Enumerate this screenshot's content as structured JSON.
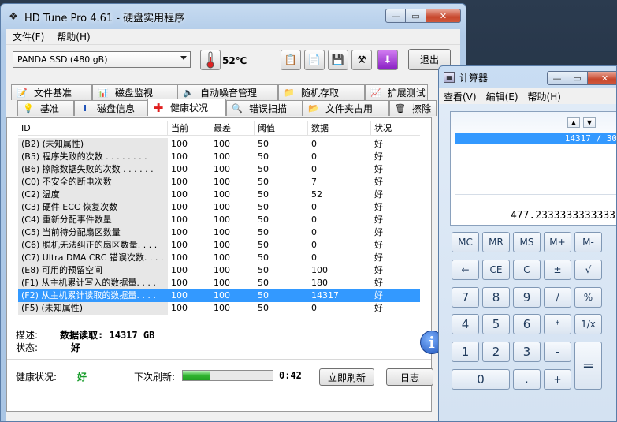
{
  "hdtune": {
    "title": "HD Tune Pro 4.61 - 硬盘实用程序",
    "menu": [
      "文件(F)",
      "帮助(H)"
    ],
    "drive": "PANDA SSD (480 gB)",
    "temperature": "52℃",
    "exit_label": "退出",
    "tabs_back": [
      {
        "label": "文件基准",
        "icon": "file-bench-icon"
      },
      {
        "label": "磁盘监视",
        "icon": "disk-monitor-icon"
      },
      {
        "label": "自动噪音管理",
        "icon": "speaker-icon"
      },
      {
        "label": "随机存取",
        "icon": "random-access-icon"
      },
      {
        "label": "扩展测试",
        "icon": "extra-tests-icon"
      }
    ],
    "tabs_front": [
      {
        "label": "基准",
        "icon": "bulb-icon"
      },
      {
        "label": "磁盘信息",
        "icon": "info-icon"
      },
      {
        "label": "健康状况",
        "icon": "health-cross-icon"
      },
      {
        "label": "错误扫描",
        "icon": "magnifier-icon"
      },
      {
        "label": "文件夹占用",
        "icon": "folder-icon"
      },
      {
        "label": "擦除",
        "icon": "trash-icon"
      }
    ],
    "columns": [
      "ID",
      "当前",
      "最差",
      "阈值",
      "数据",
      "状况"
    ],
    "rows": [
      [
        "(B2) (未知属性)",
        "100",
        "100",
        "50",
        "0",
        "好"
      ],
      [
        "(B5) 程序失败的次数 . . . . . . . .",
        "100",
        "100",
        "50",
        "0",
        "好"
      ],
      [
        "(B6) 擦除数据失败的次数 . . . . . .",
        "100",
        "100",
        "50",
        "0",
        "好"
      ],
      [
        "(C0) 不安全的断电次数",
        "100",
        "100",
        "50",
        "7",
        "好"
      ],
      [
        "(C2) 温度",
        "100",
        "100",
        "50",
        "52",
        "好"
      ],
      [
        "(C3) 硬件 ECC 恢复次数",
        "100",
        "100",
        "50",
        "0",
        "好"
      ],
      [
        "(C4) 重新分配事件数量",
        "100",
        "100",
        "50",
        "0",
        "好"
      ],
      [
        "(C5) 当前待分配扇区数量",
        "100",
        "100",
        "50",
        "0",
        "好"
      ],
      [
        "(C6) 脱机无法纠正的扇区数量. . . .",
        "100",
        "100",
        "50",
        "0",
        "好"
      ],
      [
        "(C7) Ultra DMA CRC 错误次数. . . .",
        "100",
        "100",
        "50",
        "0",
        "好"
      ],
      [
        "(E8) 可用的预留空间",
        "100",
        "100",
        "50",
        "100",
        "好"
      ],
      [
        "(F1) 从主机累计写入的数据量. . . .",
        "100",
        "100",
        "50",
        "180",
        "好"
      ],
      [
        "(F2) 从主机累计读取的数据量. . . .",
        "100",
        "100",
        "50",
        "14317",
        "好"
      ],
      [
        "(F5) (未知属性)",
        "100",
        "100",
        "50",
        "0",
        "好"
      ]
    ],
    "selected_row": 12,
    "desc_label": "描述:",
    "desc_value": "数据读取: 14317 GB",
    "state_label": "状态:",
    "state_value": "好",
    "health_label": "健康状况:",
    "health_value": "好",
    "next_refresh_label": "下次刷新:",
    "refresh_progress": 0.3,
    "timer": "0:42",
    "refresh_button": "立即刷新",
    "log_button": "日志"
  },
  "calculator": {
    "title": "计算器",
    "menu": [
      "查看(V)",
      "编辑(E)",
      "帮助(H)"
    ],
    "history": "14317 / 30",
    "result": "477.2333333333333",
    "keys": [
      [
        "MC",
        "MR",
        "MS",
        "M+",
        "M-"
      ],
      [
        "←",
        "CE",
        "C",
        "±",
        "√"
      ],
      [
        "7",
        "8",
        "9",
        "/",
        "%"
      ],
      [
        "4",
        "5",
        "6",
        "*",
        "1/x"
      ],
      [
        "1",
        "2",
        "3",
        "-",
        "="
      ],
      [
        "0",
        ".",
        "+"
      ]
    ]
  },
  "colors": {
    "selection": "#3399ff",
    "health_good": "#179c2a"
  }
}
